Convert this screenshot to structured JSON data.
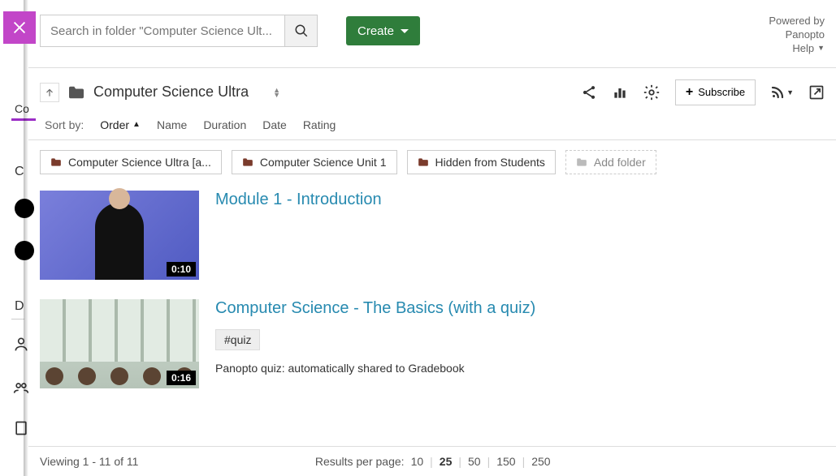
{
  "powered": {
    "line1": "Powered by",
    "line2": "Panopto",
    "help": "Help"
  },
  "search": {
    "placeholder": "Search in folder \"Computer Science Ult..."
  },
  "create": {
    "label": "Create"
  },
  "breadcrumb": {
    "folder_title": "Computer Science Ultra"
  },
  "actions": {
    "subscribe_label": "Subscribe"
  },
  "sort": {
    "label": "Sort by:",
    "active": "Order",
    "options": [
      "Name",
      "Duration",
      "Date",
      "Rating"
    ]
  },
  "subfolders": [
    {
      "label": "Computer Science Ultra [a..."
    },
    {
      "label": "Computer Science Unit 1"
    },
    {
      "label": "Hidden from Students"
    }
  ],
  "add_folder_label": "Add folder",
  "videos": [
    {
      "title": "Module 1 - Introduction",
      "duration": "0:10",
      "tag": null,
      "note": null
    },
    {
      "title": "Computer Science - The Basics (with a quiz)",
      "duration": "0:16",
      "tag": "#quiz",
      "note": "Panopto quiz: automatically shared to Gradebook"
    }
  ],
  "footer": {
    "viewing": "Viewing 1 - 11 of 11",
    "rpp_label": "Results per page:",
    "rpp_options": [
      "10",
      "25",
      "50",
      "150",
      "250"
    ],
    "rpp_current": "25"
  },
  "left_strip": {
    "co": "Co",
    "c": "C",
    "d": "D"
  }
}
